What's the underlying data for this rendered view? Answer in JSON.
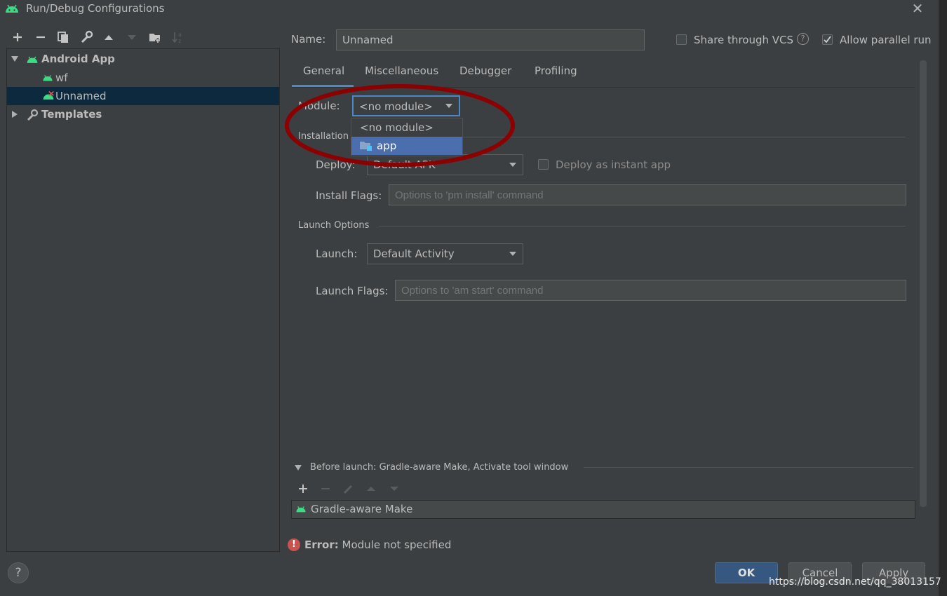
{
  "window": {
    "title": "Run/Debug Configurations",
    "close_symbol": "✕"
  },
  "toolbar": {
    "icons": [
      "add-icon",
      "remove-icon",
      "copy-icon",
      "wrench-icon",
      "move-up-icon",
      "move-down-icon",
      "new-folder-icon",
      "sort-icon"
    ]
  },
  "tree": {
    "root_label": "Android App",
    "children": [
      "wf",
      "Unnamed"
    ],
    "templates_label": "Templates"
  },
  "form": {
    "name_label": "Name:",
    "name_value": "Unnamed",
    "share_vcs_label": "Share through VCS",
    "allow_parallel_label": "Allow parallel run",
    "allow_parallel_checked": true,
    "share_vcs_checked": false
  },
  "tabs": [
    "General",
    "Miscellaneous",
    "Debugger",
    "Profiling"
  ],
  "active_tab": "General",
  "module": {
    "label": "Module:",
    "value": "<no module>",
    "options": [
      "<no module>",
      "app"
    ],
    "highlighted_option": "app"
  },
  "installation": {
    "section_title": "Installation",
    "deploy_label": "Deploy:",
    "deploy_value": "Default APK",
    "instant_app_label": "Deploy as instant app",
    "install_flags_label": "Install Flags:",
    "install_flags_placeholder": "Options to 'pm install' command"
  },
  "launch": {
    "section_title": "Launch Options",
    "launch_label": "Launch:",
    "launch_value": "Default Activity",
    "launch_flags_label": "Launch Flags:",
    "launch_flags_placeholder": "Options to 'am start' command"
  },
  "before_launch": {
    "title": "Before launch: Gradle-aware Make, Activate tool window",
    "task": "Gradle-aware Make"
  },
  "error": {
    "prefix": "Error:",
    "message": "Module not specified"
  },
  "buttons": {
    "ok": "OK",
    "cancel": "Cancel",
    "apply": "Apply"
  },
  "watermark": "https://blog.csdn.net/qq_38013157",
  "colors": {
    "accent": "#4a88c7",
    "android_green": "#3ddc84",
    "error_red": "#c75450",
    "annotation_red": "#8b0000"
  }
}
